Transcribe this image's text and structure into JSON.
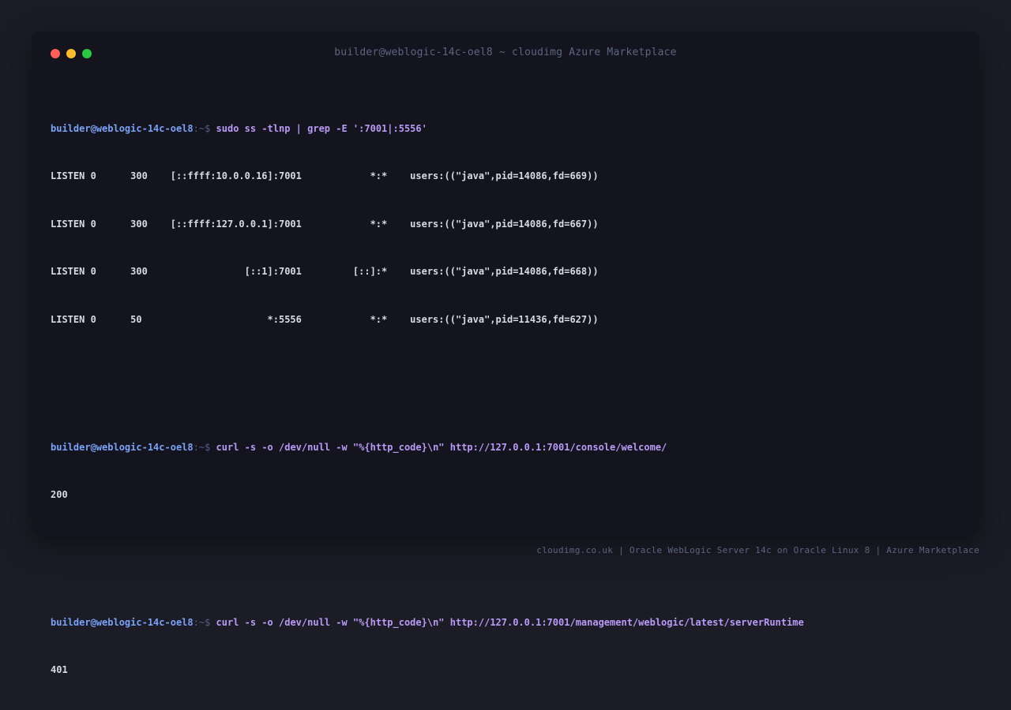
{
  "window": {
    "title": "builder@weblogic-14c-oel8 ~ cloudimg Azure Marketplace",
    "controls": {
      "close_color": "#ff5f57",
      "minimize_color": "#febc2e",
      "maximize_color": "#28c840"
    }
  },
  "terminal": {
    "prompt_user": "builder@weblogic-14c-oel8",
    "prompt_suffix": ":~$ ",
    "colors": {
      "prompt": "#7aa2f7",
      "command": "#bb9af7",
      "output": "#d7dae6"
    },
    "blocks": [
      {
        "command": "sudo ss -tlnp | grep -E ':7001|:5556'",
        "output": [
          "LISTEN 0      300    [::ffff:10.0.0.16]:7001            *:*    users:((\"java\",pid=14086,fd=669))",
          "LISTEN 0      300    [::ffff:127.0.0.1]:7001            *:*    users:((\"java\",pid=14086,fd=667))",
          "LISTEN 0      300                 [::1]:7001         [::]:*    users:((\"java\",pid=14086,fd=668))",
          "LISTEN 0      50                      *:5556            *:*    users:((\"java\",pid=11436,fd=627))"
        ]
      },
      {
        "command": "curl -s -o /dev/null -w \"%{http_code}\\n\" http://127.0.0.1:7001/console/welcome/",
        "output": [
          "200"
        ]
      },
      {
        "command": "curl -s -o /dev/null -w \"%{http_code}\\n\" http://127.0.0.1:7001/management/weblogic/latest/serverRuntime",
        "output": [
          "401"
        ]
      }
    ]
  },
  "footer": {
    "text": "cloudimg.co.uk | Oracle WebLogic Server 14c on Oracle Linux 8 | Azure Marketplace"
  }
}
